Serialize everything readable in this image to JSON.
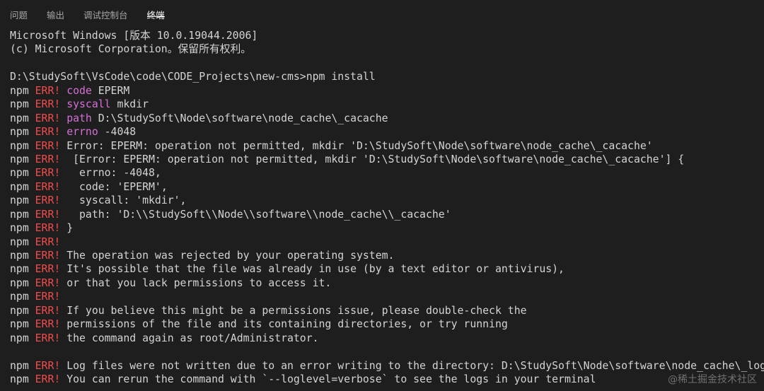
{
  "tabs": [
    {
      "label": "问题"
    },
    {
      "label": "输出"
    },
    {
      "label": "调试控制台"
    },
    {
      "label": "终端",
      "active": true
    }
  ],
  "terminal": {
    "prefix_npm": "npm",
    "prefix_err": "ERR!",
    "lines": [
      {
        "kind": "plain",
        "text": "Microsoft Windows [版本 10.0.19044.2006]"
      },
      {
        "kind": "plain",
        "text": "(c) Microsoft Corporation。保留所有权利。"
      },
      {
        "kind": "plain",
        "text": ""
      },
      {
        "kind": "plain",
        "text": "D:\\StudySoft\\VsCode\\code\\CODE_Projects\\new-cms>npm install"
      },
      {
        "kind": "err",
        "key": "code",
        "text": "EPERM"
      },
      {
        "kind": "err",
        "key": "syscall",
        "text": "mkdir"
      },
      {
        "kind": "err",
        "key": "path",
        "text": "D:\\StudySoft\\Node\\software\\node_cache\\_cacache"
      },
      {
        "kind": "err",
        "key": "errno",
        "text": "-4048"
      },
      {
        "kind": "err",
        "text": "Error: EPERM: operation not permitted, mkdir 'D:\\StudySoft\\Node\\software\\node_cache\\_cacache'"
      },
      {
        "kind": "err",
        "text": " [Error: EPERM: operation not permitted, mkdir 'D:\\StudySoft\\Node\\software\\node_cache\\_cacache'] {"
      },
      {
        "kind": "err",
        "text": "  errno: -4048,"
      },
      {
        "kind": "err",
        "text": "  code: 'EPERM',"
      },
      {
        "kind": "err",
        "text": "  syscall: 'mkdir',"
      },
      {
        "kind": "err",
        "text": "  path: 'D:\\\\StudySoft\\\\Node\\\\software\\\\node_cache\\\\_cacache'"
      },
      {
        "kind": "err",
        "text": "}"
      },
      {
        "kind": "err",
        "text": ""
      },
      {
        "kind": "err",
        "text": "The operation was rejected by your operating system."
      },
      {
        "kind": "err",
        "text": "It's possible that the file was already in use (by a text editor or antivirus),"
      },
      {
        "kind": "err",
        "text": "or that you lack permissions to access it."
      },
      {
        "kind": "err",
        "text": ""
      },
      {
        "kind": "err",
        "text": "If you believe this might be a permissions issue, please double-check the"
      },
      {
        "kind": "err",
        "text": "permissions of the file and its containing directories, or try running"
      },
      {
        "kind": "err",
        "text": "the command again as root/Administrator."
      },
      {
        "kind": "plain",
        "text": ""
      },
      {
        "kind": "err",
        "text": "Log files were not written due to an error writing to the directory: D:\\StudySoft\\Node\\software\\node_cache\\_logs"
      },
      {
        "kind": "err",
        "text": "You can rerun the command with `--loglevel=verbose` to see the logs in your terminal"
      }
    ]
  },
  "watermark": "@稀土掘金技术社区",
  "colors": {
    "background": "#1e1e1e",
    "text": "#d4d4d4",
    "err": "#f14c4c",
    "key": "#d670d6",
    "tab_inactive": "#a7a7a7",
    "tab_active": "#ffffff"
  }
}
